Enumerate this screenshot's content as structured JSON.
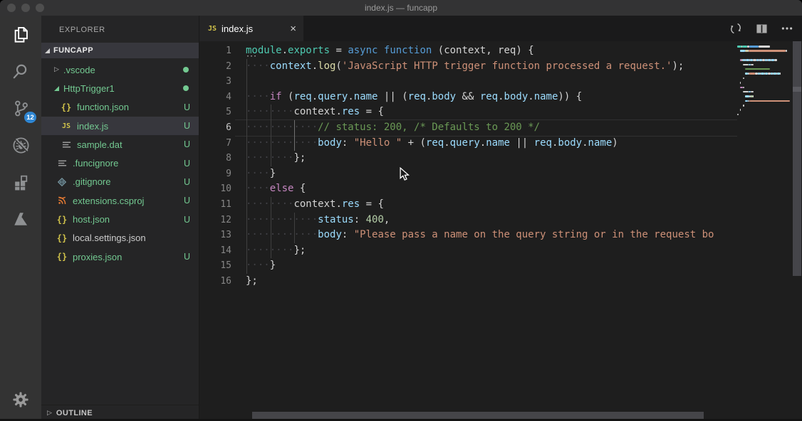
{
  "window": {
    "title": "index.js — funcapp"
  },
  "activity_bar": {
    "items": [
      {
        "id": "explorer",
        "active": true
      },
      {
        "id": "search",
        "active": false
      },
      {
        "id": "source-control",
        "active": false,
        "badge": "12"
      },
      {
        "id": "debug",
        "active": false
      },
      {
        "id": "extensions",
        "active": false
      },
      {
        "id": "azure",
        "active": false
      }
    ],
    "settings": "settings"
  },
  "explorer": {
    "title": "EXPLORER",
    "section": "FUNCAPP",
    "outline_label": "OUTLINE",
    "items": [
      {
        "name": ".vscode",
        "kind": "folder",
        "expanded": false,
        "indent": 0,
        "green": true,
        "badge": "dot"
      },
      {
        "name": "HttpTrigger1",
        "kind": "folder",
        "expanded": true,
        "indent": 0,
        "green": true,
        "badge": "dot"
      },
      {
        "name": "function.json",
        "kind": "file",
        "icon": "braces",
        "indent": 1,
        "green": true,
        "badge": "U"
      },
      {
        "name": "index.js",
        "kind": "file",
        "icon": "js",
        "indent": 1,
        "green": true,
        "badge": "U",
        "selected": true
      },
      {
        "name": "sample.dat",
        "kind": "file",
        "icon": "lines",
        "indent": 1,
        "green": true,
        "badge": "U"
      },
      {
        "name": ".funcignore",
        "kind": "file",
        "icon": "lines",
        "indent": 0,
        "green": true,
        "badge": "U"
      },
      {
        "name": ".gitignore",
        "kind": "file",
        "icon": "git",
        "indent": 0,
        "green": true,
        "badge": "U"
      },
      {
        "name": "extensions.csproj",
        "kind": "file",
        "icon": "xml",
        "indent": 0,
        "green": true,
        "badge": "U"
      },
      {
        "name": "host.json",
        "kind": "file",
        "icon": "braces",
        "indent": 0,
        "green": true,
        "badge": "U"
      },
      {
        "name": "local.settings.json",
        "kind": "file",
        "icon": "braces",
        "indent": 0,
        "green": false,
        "badge": ""
      },
      {
        "name": "proxies.json",
        "kind": "file",
        "icon": "braces",
        "indent": 0,
        "green": true,
        "badge": "U"
      }
    ]
  },
  "editor": {
    "tab": {
      "label": "index.js",
      "icon_text": "JS",
      "close_glyph": "×"
    },
    "unused_hint_dots": "···",
    "current_line": 6,
    "token_colors": {
      "teal": "#4ec9b0",
      "kw": "#569cd6",
      "ctrl": "#c586c0",
      "var": "#9cdcfe",
      "fg": "#d4d4d4",
      "fn": "#dcdcaa",
      "str": "#ce9178",
      "cmt": "#6a9955",
      "num": "#b5cea8",
      "ws": "#404045"
    },
    "guides": [
      {
        "col": 0,
        "from": 2,
        "to": 15,
        "active": false
      },
      {
        "col": 4,
        "from": 5,
        "to": 8,
        "active": false
      },
      {
        "col": 4,
        "from": 11,
        "to": 14,
        "active": false
      },
      {
        "col": 8,
        "from": 6,
        "to": 7,
        "active": true
      },
      {
        "col": 8,
        "from": 12,
        "to": 13,
        "active": false
      }
    ],
    "lines": [
      {
        "n": 1,
        "tokens": [
          [
            "teal",
            "module"
          ],
          [
            "fg",
            "."
          ],
          [
            "teal",
            "exports"
          ],
          [
            "fg",
            " = "
          ],
          [
            "kw",
            "async function"
          ],
          [
            "fg",
            " (context, req) {"
          ]
        ]
      },
      {
        "n": 2,
        "tokens": [
          [
            "ws",
            "····"
          ],
          [
            "var",
            "context"
          ],
          [
            "fg",
            "."
          ],
          [
            "fn",
            "log"
          ],
          [
            "fg",
            "("
          ],
          [
            "str",
            "'JavaScript HTTP trigger function processed a request.'"
          ],
          [
            "fg",
            ");"
          ]
        ]
      },
      {
        "n": 3,
        "tokens": []
      },
      {
        "n": 4,
        "tokens": [
          [
            "ws",
            "····"
          ],
          [
            "ctrl",
            "if"
          ],
          [
            "fg",
            " ("
          ],
          [
            "var",
            "req"
          ],
          [
            "fg",
            "."
          ],
          [
            "var",
            "query"
          ],
          [
            "fg",
            "."
          ],
          [
            "var",
            "name"
          ],
          [
            "fg",
            " || ("
          ],
          [
            "var",
            "req"
          ],
          [
            "fg",
            "."
          ],
          [
            "var",
            "body"
          ],
          [
            "fg",
            " && "
          ],
          [
            "var",
            "req"
          ],
          [
            "fg",
            "."
          ],
          [
            "var",
            "body"
          ],
          [
            "fg",
            "."
          ],
          [
            "var",
            "name"
          ],
          [
            "fg",
            ")) {"
          ]
        ]
      },
      {
        "n": 5,
        "tokens": [
          [
            "ws",
            "········"
          ],
          [
            "fg",
            "context."
          ],
          [
            "var",
            "res"
          ],
          [
            "fg",
            " = {"
          ]
        ]
      },
      {
        "n": 6,
        "tokens": [
          [
            "ws",
            "············"
          ],
          [
            "cmt",
            "// status: 200, /* Defaults to 200 */"
          ]
        ]
      },
      {
        "n": 7,
        "tokens": [
          [
            "ws",
            "············"
          ],
          [
            "var",
            "body"
          ],
          [
            "fg",
            ": "
          ],
          [
            "str",
            "\"Hello \""
          ],
          [
            "fg",
            " + ("
          ],
          [
            "var",
            "req"
          ],
          [
            "fg",
            "."
          ],
          [
            "var",
            "query"
          ],
          [
            "fg",
            "."
          ],
          [
            "var",
            "name"
          ],
          [
            "fg",
            " || "
          ],
          [
            "var",
            "req"
          ],
          [
            "fg",
            "."
          ],
          [
            "var",
            "body"
          ],
          [
            "fg",
            "."
          ],
          [
            "var",
            "name"
          ],
          [
            "fg",
            ")"
          ]
        ]
      },
      {
        "n": 8,
        "tokens": [
          [
            "ws",
            "········"
          ],
          [
            "fg",
            "};"
          ]
        ]
      },
      {
        "n": 9,
        "tokens": [
          [
            "ws",
            "····"
          ],
          [
            "fg",
            "}"
          ]
        ]
      },
      {
        "n": 10,
        "tokens": [
          [
            "ws",
            "····"
          ],
          [
            "ctrl",
            "else"
          ],
          [
            "fg",
            " {"
          ]
        ]
      },
      {
        "n": 11,
        "tokens": [
          [
            "ws",
            "········"
          ],
          [
            "fg",
            "context."
          ],
          [
            "var",
            "res"
          ],
          [
            "fg",
            " = {"
          ]
        ]
      },
      {
        "n": 12,
        "tokens": [
          [
            "ws",
            "············"
          ],
          [
            "var",
            "status"
          ],
          [
            "fg",
            ": "
          ],
          [
            "num",
            "400"
          ],
          [
            "fg",
            ","
          ]
        ]
      },
      {
        "n": 13,
        "tokens": [
          [
            "ws",
            "············"
          ],
          [
            "var",
            "body"
          ],
          [
            "fg",
            ": "
          ],
          [
            "str",
            "\"Please pass a name on the query string or in the request bo"
          ]
        ]
      },
      {
        "n": 14,
        "tokens": [
          [
            "ws",
            "········"
          ],
          [
            "fg",
            "};"
          ]
        ]
      },
      {
        "n": 15,
        "tokens": [
          [
            "ws",
            "····"
          ],
          [
            "fg",
            "}"
          ]
        ]
      },
      {
        "n": 16,
        "tokens": [
          [
            "fg",
            "};"
          ]
        ]
      }
    ]
  },
  "colors": {
    "badge_blue": "#2f86d2",
    "git_green": "#73c991",
    "icon_yellow": "#d0c24a",
    "icon_orange": "#e37933",
    "icon_gitfile": "#7a99a3",
    "name_default": "#cccccc"
  }
}
